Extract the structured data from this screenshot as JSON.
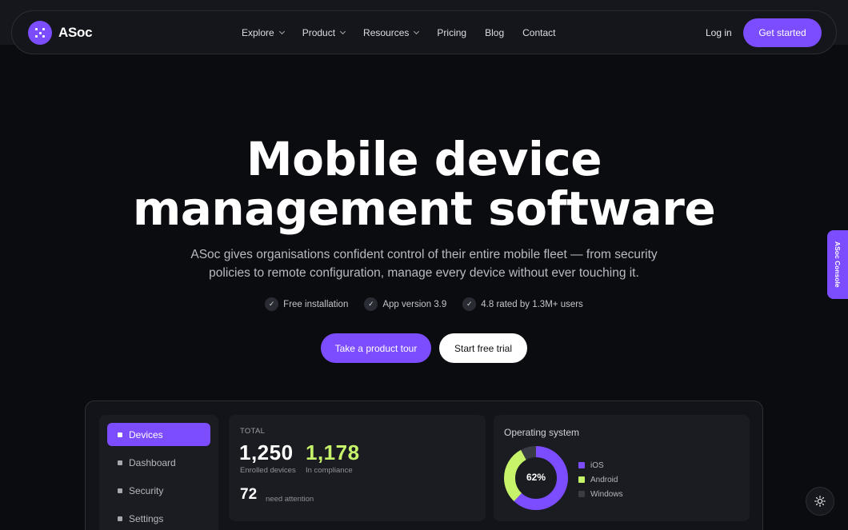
{
  "brand": {
    "name": "ASoc",
    "accent": "#7c4dff"
  },
  "nav": {
    "links": [
      {
        "label": "Explore",
        "has_dropdown": true
      },
      {
        "label": "Product",
        "has_dropdown": true
      },
      {
        "label": "Resources",
        "has_dropdown": true
      },
      {
        "label": "Pricing",
        "has_dropdown": false
      },
      {
        "label": "Blog",
        "has_dropdown": false
      },
      {
        "label": "Contact",
        "has_dropdown": false
      }
    ],
    "login": "Log in",
    "cta": "Get started"
  },
  "hero": {
    "title_line1": "Mobile device",
    "title_line2": "management software",
    "subtitle": "ASoc gives organisations confident control of their entire mobile fleet — from security policies to remote configuration, manage every device without ever touching it.",
    "badges": [
      "Free installation",
      "App version 3.9",
      "4.8 rated by 1.3M+ users"
    ],
    "primary_button": "Take a product tour",
    "secondary_button": "Start free trial"
  },
  "console_tab": "ASoc Console",
  "dashboard": {
    "sidebar": [
      "Devices",
      "Dashboard",
      "Security",
      "Settings"
    ],
    "active_item": "Devices",
    "total": {
      "label": "TOTAL",
      "enrolled_value": "1,250",
      "enrolled_label": "Enrolled devices",
      "compliance_value": "1,178",
      "compliance_label": "In compliance",
      "compliance_color": "#c6f36a",
      "attention_value": "72",
      "attention_label": "need attention"
    },
    "os": {
      "title": "Operating system",
      "center_label": "62%",
      "segments": [
        {
          "name": "iOS",
          "share": 0.62,
          "color": "#7c4dff"
        },
        {
          "name": "Android",
          "share": 0.3,
          "color": "#c6f36a"
        },
        {
          "name": "Windows",
          "share": 0.08,
          "color": "#3a3c44"
        }
      ]
    }
  },
  "icons": {
    "theme_toggle": "sun-icon",
    "brand": "logo-dots-icon"
  }
}
